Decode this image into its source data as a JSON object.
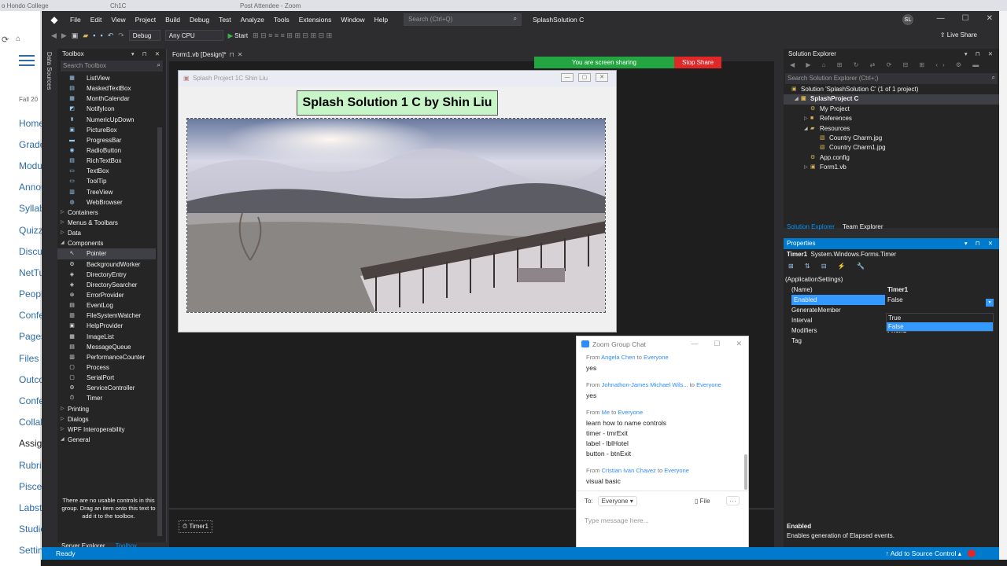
{
  "browser": {
    "tabs": [
      "o Hondo College",
      "Ch1C",
      "Post Attendee - Zoom"
    ],
    "left_nav": [
      "Home",
      "Grades",
      "Modules",
      "Announcements",
      "Syllabus",
      "Quizzes",
      "Discussions",
      "NetTutor",
      "People",
      "Conferences",
      "Pages",
      "Files",
      "Outcomes",
      "Conferences",
      "Collaborations",
      "Assignments",
      "Rubrics",
      "Piscene",
      "Labster",
      "Studio",
      "Settings"
    ],
    "fall_label": "Fall 20"
  },
  "vs": {
    "menu": [
      "File",
      "Edit",
      "View",
      "Project",
      "Build",
      "Debug",
      "Test",
      "Analyze",
      "Tools",
      "Extensions",
      "Window",
      "Help"
    ],
    "search_placeholder": "Search (Ctrl+Q)",
    "solution_title": "SplashSolution C",
    "user_initials": "SL",
    "config": "Debug",
    "platform": "Any CPU",
    "start_label": "Start",
    "live_share": "Live Share"
  },
  "toolbox": {
    "title": "Toolbox",
    "search_placeholder": "Search Toolbox",
    "items_top": [
      "ListView",
      "MaskedTextBox",
      "MonthCalendar",
      "NotifyIcon",
      "NumericUpDown",
      "PictureBox",
      "ProgressBar",
      "RadioButton",
      "RichTextBox",
      "TextBox",
      "ToolTip",
      "TreeView",
      "WebBrowser"
    ],
    "cats_mid": [
      "Containers",
      "Menus & Toolbars",
      "Data",
      "Components"
    ],
    "components": [
      "Pointer",
      "BackgroundWorker",
      "DirectoryEntry",
      "DirectorySearcher",
      "ErrorProvider",
      "EventLog",
      "FileSystemWatcher",
      "HelpProvider",
      "ImageList",
      "MessageQueue",
      "PerformanceCounter",
      "Process",
      "SerialPort",
      "ServiceController",
      "Timer"
    ],
    "cats_bottom": [
      "Printing",
      "Dialogs",
      "WPF Interoperability",
      "General"
    ],
    "note": "There are no usable controls in this group. Drag an item onto this text to add it to the toolbox.",
    "bottom_tabs": [
      "Server Explorer",
      "Toolbox"
    ],
    "side_tab": "Data Sources"
  },
  "document": {
    "tab_label": "Form1.vb [Design]*",
    "form_title": "Splash Project 1C  Shin Liu",
    "label_text": "Splash Solution 1 C by Shin Liu",
    "tray_item": "Timer1"
  },
  "sharing": {
    "status": "You are screen sharing",
    "stop": "Stop Share"
  },
  "chat": {
    "title": "Zoom Group Chat",
    "messages": [
      {
        "from": "Angela Chen",
        "to": "Everyone",
        "lines": [
          "yes"
        ]
      },
      {
        "from": "Johnathon-James Michael Wils...",
        "to": "Everyone",
        "lines": [
          "yes"
        ]
      },
      {
        "from": "Me",
        "to": "Everyone",
        "lines": [
          "learn how to name controls",
          "timer  - tmrExit",
          "label  - lblHotel",
          "button - btnExit"
        ]
      },
      {
        "from": "Cristian Ivan Chavez",
        "to": "Everyone",
        "lines": [
          "visual basic"
        ]
      }
    ],
    "to_label": "To:",
    "to_value": "Everyone",
    "file_label": "File",
    "input_placeholder": "Type message here..."
  },
  "solution_explorer": {
    "title": "Solution Explorer",
    "search_placeholder": "Search Solution Explorer (Ctrl+;)",
    "tree": [
      {
        "label": "Solution 'SplashSolution C' (1 of 1 project)",
        "indent": 0
      },
      {
        "label": "SplashProject C",
        "indent": 1
      },
      {
        "label": "My Project",
        "indent": 2
      },
      {
        "label": "References",
        "indent": 2
      },
      {
        "label": "Resources",
        "indent": 2
      },
      {
        "label": "Country Charm.jpg",
        "indent": 3
      },
      {
        "label": "Country Charm1.jpg",
        "indent": 3
      },
      {
        "label": "App.config",
        "indent": 2
      },
      {
        "label": "Form1.vb",
        "indent": 2
      }
    ],
    "tabs": [
      "Solution Explorer",
      "Team Explorer"
    ]
  },
  "properties": {
    "title": "Properties",
    "object_name": "Timer1",
    "object_type": "System.Windows.Forms.Timer",
    "rows": [
      {
        "k": "(ApplicationSettings)",
        "v": ""
      },
      {
        "k": "(Name)",
        "v": "Timer1"
      },
      {
        "k": "Enabled",
        "v": "False"
      },
      {
        "k": "GenerateMember",
        "v": ""
      },
      {
        "k": "Interval",
        "v": ""
      },
      {
        "k": "Modifiers",
        "v": "Friend"
      },
      {
        "k": "Tag",
        "v": ""
      }
    ],
    "dropdown_options": [
      "True",
      "False"
    ],
    "desc_title": "Enabled",
    "desc_text": "Enables generation of Elapsed events."
  },
  "statusbar": {
    "left": "Ready",
    "right": "Add to Source Control"
  },
  "colors": {
    "vs_blue": "#007acc",
    "share_green": "#23a641",
    "stop_red": "#e02828",
    "label_green": "#c8f5c8"
  }
}
